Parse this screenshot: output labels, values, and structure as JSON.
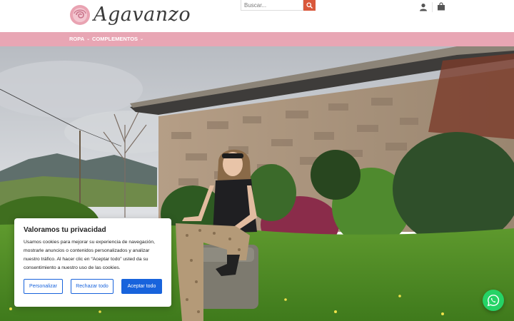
{
  "header": {
    "logo_text": "Agavanzo",
    "search": {
      "placeholder": "Buscar...",
      "value": ""
    },
    "icons": {
      "search": "search-icon",
      "account": "user-icon",
      "cart": "shopping-bag-icon"
    }
  },
  "nav": {
    "items": [
      {
        "label": "ROPA",
        "has_dropdown": true
      },
      {
        "label": "COMPLEMENTOS",
        "has_dropdown": true
      }
    ]
  },
  "cookie_banner": {
    "title": "Valoramos tu privacidad",
    "body": "Usamos cookies para mejorar su experiencia de navegación, mostrarle anuncios o contenidos personalizados y analizar nuestro tráfico. Al hacer clic en “Aceptar todo” usted da su consentimiento a nuestro uso de las cookies.",
    "buttons": {
      "customize": "Personalizar",
      "reject": "Rechazar todo",
      "accept": "Aceptar todo"
    }
  },
  "floating": {
    "whatsapp": "whatsapp-icon"
  },
  "colors": {
    "nav_bg": "#e8a6b4",
    "search_button": "#d9583b",
    "cookie_accent": "#1863dc",
    "whatsapp": "#25d366"
  }
}
